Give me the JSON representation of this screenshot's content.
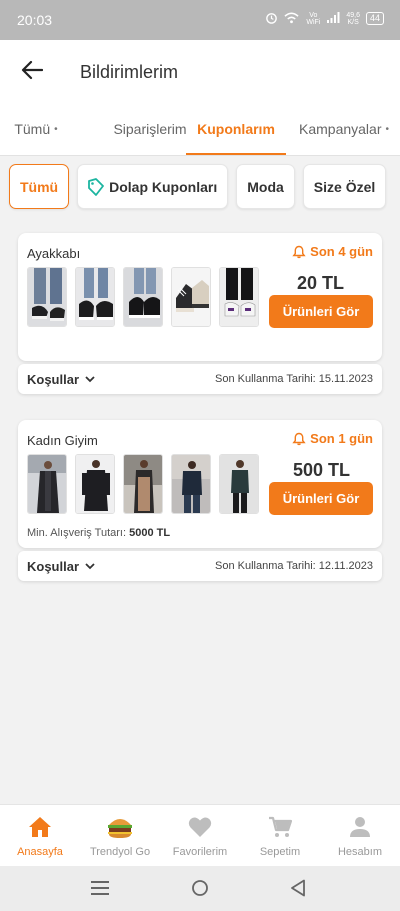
{
  "status_bar": {
    "time": "20:03",
    "net_label": "Vo WiFi",
    "speed": "49,6",
    "speed_unit": "K/S",
    "battery": "44"
  },
  "header": {
    "title": "Bildirimlerim"
  },
  "tabs": [
    {
      "label": "Tümü",
      "dot": "•"
    },
    {
      "label": "Siparişlerim",
      "dot": ""
    },
    {
      "label": "Kuponlarım",
      "dot": ""
    },
    {
      "label": "Kampanyalar",
      "dot": "•"
    }
  ],
  "filters": [
    "Tümü",
    "Dolap Kuponları",
    "Moda",
    "Size Özel"
  ],
  "coupons": [
    {
      "title": "Ayakkabı",
      "days_left": "Son 4 gün",
      "amount": "20 TL",
      "button": "Ürünleri Gör",
      "min_label": "",
      "min_value": "",
      "conditions": "Koşullar",
      "expiry": "Son Kullanma Tarihi: 15.11.2023"
    },
    {
      "title": "Kadın Giyim",
      "days_left": "Son 1 gün",
      "amount": "500 TL",
      "button": "Ürünleri Gör",
      "min_label": "Min. Alışveriş Tutarı:",
      "min_value": "5000 TL",
      "conditions": "Koşullar",
      "expiry": "Son Kullanma Tarihi: 12.11.2023"
    }
  ],
  "bottom_nav": [
    {
      "label": "Anasayfa",
      "icon": "home-icon"
    },
    {
      "label": "Trendyol Go",
      "icon": "burger-icon"
    },
    {
      "label": "Favorilerim",
      "icon": "heart-icon"
    },
    {
      "label": "Sepetim",
      "icon": "cart-icon"
    },
    {
      "label": "Hesabım",
      "icon": "user-icon"
    }
  ],
  "colors": {
    "accent": "#f27a1a",
    "background": "#f2f2f2",
    "status_bar": "#b8b8b8"
  }
}
